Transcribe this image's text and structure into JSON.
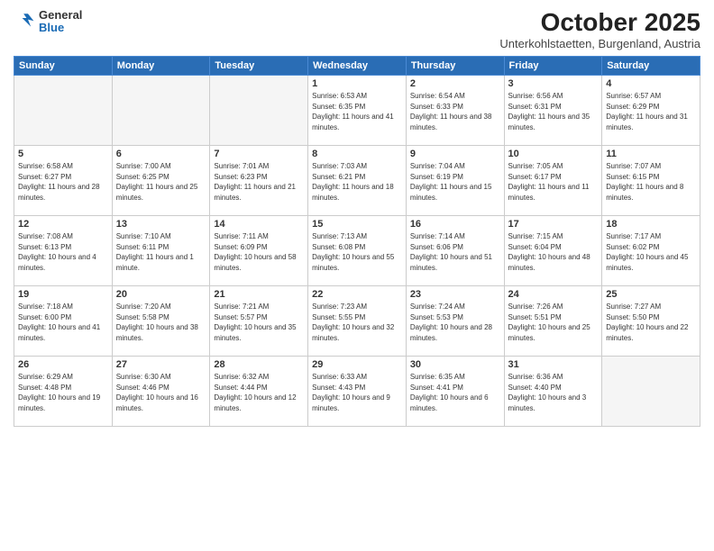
{
  "header": {
    "logo": {
      "general": "General",
      "blue": "Blue"
    },
    "title": "October 2025",
    "subtitle": "Unterkohlstaetten, Burgenland, Austria"
  },
  "weekdays": [
    "Sunday",
    "Monday",
    "Tuesday",
    "Wednesday",
    "Thursday",
    "Friday",
    "Saturday"
  ],
  "weeks": [
    [
      {
        "day": "",
        "empty": true
      },
      {
        "day": "",
        "empty": true
      },
      {
        "day": "",
        "empty": true
      },
      {
        "day": "1",
        "sunrise": "6:53 AM",
        "sunset": "6:35 PM",
        "daylight": "11 hours and 41 minutes."
      },
      {
        "day": "2",
        "sunrise": "6:54 AM",
        "sunset": "6:33 PM",
        "daylight": "11 hours and 38 minutes."
      },
      {
        "day": "3",
        "sunrise": "6:56 AM",
        "sunset": "6:31 PM",
        "daylight": "11 hours and 35 minutes."
      },
      {
        "day": "4",
        "sunrise": "6:57 AM",
        "sunset": "6:29 PM",
        "daylight": "11 hours and 31 minutes."
      }
    ],
    [
      {
        "day": "5",
        "sunrise": "6:58 AM",
        "sunset": "6:27 PM",
        "daylight": "11 hours and 28 minutes."
      },
      {
        "day": "6",
        "sunrise": "7:00 AM",
        "sunset": "6:25 PM",
        "daylight": "11 hours and 25 minutes."
      },
      {
        "day": "7",
        "sunrise": "7:01 AM",
        "sunset": "6:23 PM",
        "daylight": "11 hours and 21 minutes."
      },
      {
        "day": "8",
        "sunrise": "7:03 AM",
        "sunset": "6:21 PM",
        "daylight": "11 hours and 18 minutes."
      },
      {
        "day": "9",
        "sunrise": "7:04 AM",
        "sunset": "6:19 PM",
        "daylight": "11 hours and 15 minutes."
      },
      {
        "day": "10",
        "sunrise": "7:05 AM",
        "sunset": "6:17 PM",
        "daylight": "11 hours and 11 minutes."
      },
      {
        "day": "11",
        "sunrise": "7:07 AM",
        "sunset": "6:15 PM",
        "daylight": "11 hours and 8 minutes."
      }
    ],
    [
      {
        "day": "12",
        "sunrise": "7:08 AM",
        "sunset": "6:13 PM",
        "daylight": "10 hours and 4 minutes."
      },
      {
        "day": "13",
        "sunrise": "7:10 AM",
        "sunset": "6:11 PM",
        "daylight": "11 hours and 1 minute."
      },
      {
        "day": "14",
        "sunrise": "7:11 AM",
        "sunset": "6:09 PM",
        "daylight": "10 hours and 58 minutes."
      },
      {
        "day": "15",
        "sunrise": "7:13 AM",
        "sunset": "6:08 PM",
        "daylight": "10 hours and 55 minutes."
      },
      {
        "day": "16",
        "sunrise": "7:14 AM",
        "sunset": "6:06 PM",
        "daylight": "10 hours and 51 minutes."
      },
      {
        "day": "17",
        "sunrise": "7:15 AM",
        "sunset": "6:04 PM",
        "daylight": "10 hours and 48 minutes."
      },
      {
        "day": "18",
        "sunrise": "7:17 AM",
        "sunset": "6:02 PM",
        "daylight": "10 hours and 45 minutes."
      }
    ],
    [
      {
        "day": "19",
        "sunrise": "7:18 AM",
        "sunset": "6:00 PM",
        "daylight": "10 hours and 41 minutes."
      },
      {
        "day": "20",
        "sunrise": "7:20 AM",
        "sunset": "5:58 PM",
        "daylight": "10 hours and 38 minutes."
      },
      {
        "day": "21",
        "sunrise": "7:21 AM",
        "sunset": "5:57 PM",
        "daylight": "10 hours and 35 minutes."
      },
      {
        "day": "22",
        "sunrise": "7:23 AM",
        "sunset": "5:55 PM",
        "daylight": "10 hours and 32 minutes."
      },
      {
        "day": "23",
        "sunrise": "7:24 AM",
        "sunset": "5:53 PM",
        "daylight": "10 hours and 28 minutes."
      },
      {
        "day": "24",
        "sunrise": "7:26 AM",
        "sunset": "5:51 PM",
        "daylight": "10 hours and 25 minutes."
      },
      {
        "day": "25",
        "sunrise": "7:27 AM",
        "sunset": "5:50 PM",
        "daylight": "10 hours and 22 minutes."
      }
    ],
    [
      {
        "day": "26",
        "sunrise": "6:29 AM",
        "sunset": "4:48 PM",
        "daylight": "10 hours and 19 minutes."
      },
      {
        "day": "27",
        "sunrise": "6:30 AM",
        "sunset": "4:46 PM",
        "daylight": "10 hours and 16 minutes."
      },
      {
        "day": "28",
        "sunrise": "6:32 AM",
        "sunset": "4:44 PM",
        "daylight": "10 hours and 12 minutes."
      },
      {
        "day": "29",
        "sunrise": "6:33 AM",
        "sunset": "4:43 PM",
        "daylight": "10 hours and 9 minutes."
      },
      {
        "day": "30",
        "sunrise": "6:35 AM",
        "sunset": "4:41 PM",
        "daylight": "10 hours and 6 minutes."
      },
      {
        "day": "31",
        "sunrise": "6:36 AM",
        "sunset": "4:40 PM",
        "daylight": "10 hours and 3 minutes."
      },
      {
        "day": "",
        "empty": true
      }
    ]
  ]
}
